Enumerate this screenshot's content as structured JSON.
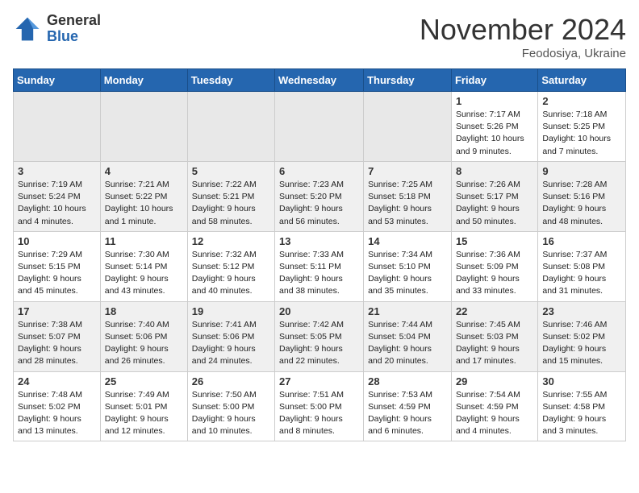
{
  "header": {
    "logo_general": "General",
    "logo_blue": "Blue",
    "month_title": "November 2024",
    "location": "Feodosiya, Ukraine"
  },
  "weekdays": [
    "Sunday",
    "Monday",
    "Tuesday",
    "Wednesday",
    "Thursday",
    "Friday",
    "Saturday"
  ],
  "weeks": [
    [
      {
        "day": "",
        "info": ""
      },
      {
        "day": "",
        "info": ""
      },
      {
        "day": "",
        "info": ""
      },
      {
        "day": "",
        "info": ""
      },
      {
        "day": "",
        "info": ""
      },
      {
        "day": "1",
        "info": "Sunrise: 7:17 AM\nSunset: 5:26 PM\nDaylight: 10 hours and 9 minutes."
      },
      {
        "day": "2",
        "info": "Sunrise: 7:18 AM\nSunset: 5:25 PM\nDaylight: 10 hours and 7 minutes."
      }
    ],
    [
      {
        "day": "3",
        "info": "Sunrise: 7:19 AM\nSunset: 5:24 PM\nDaylight: 10 hours and 4 minutes."
      },
      {
        "day": "4",
        "info": "Sunrise: 7:21 AM\nSunset: 5:22 PM\nDaylight: 10 hours and 1 minute."
      },
      {
        "day": "5",
        "info": "Sunrise: 7:22 AM\nSunset: 5:21 PM\nDaylight: 9 hours and 58 minutes."
      },
      {
        "day": "6",
        "info": "Sunrise: 7:23 AM\nSunset: 5:20 PM\nDaylight: 9 hours and 56 minutes."
      },
      {
        "day": "7",
        "info": "Sunrise: 7:25 AM\nSunset: 5:18 PM\nDaylight: 9 hours and 53 minutes."
      },
      {
        "day": "8",
        "info": "Sunrise: 7:26 AM\nSunset: 5:17 PM\nDaylight: 9 hours and 50 minutes."
      },
      {
        "day": "9",
        "info": "Sunrise: 7:28 AM\nSunset: 5:16 PM\nDaylight: 9 hours and 48 minutes."
      }
    ],
    [
      {
        "day": "10",
        "info": "Sunrise: 7:29 AM\nSunset: 5:15 PM\nDaylight: 9 hours and 45 minutes."
      },
      {
        "day": "11",
        "info": "Sunrise: 7:30 AM\nSunset: 5:14 PM\nDaylight: 9 hours and 43 minutes."
      },
      {
        "day": "12",
        "info": "Sunrise: 7:32 AM\nSunset: 5:12 PM\nDaylight: 9 hours and 40 minutes."
      },
      {
        "day": "13",
        "info": "Sunrise: 7:33 AM\nSunset: 5:11 PM\nDaylight: 9 hours and 38 minutes."
      },
      {
        "day": "14",
        "info": "Sunrise: 7:34 AM\nSunset: 5:10 PM\nDaylight: 9 hours and 35 minutes."
      },
      {
        "day": "15",
        "info": "Sunrise: 7:36 AM\nSunset: 5:09 PM\nDaylight: 9 hours and 33 minutes."
      },
      {
        "day": "16",
        "info": "Sunrise: 7:37 AM\nSunset: 5:08 PM\nDaylight: 9 hours and 31 minutes."
      }
    ],
    [
      {
        "day": "17",
        "info": "Sunrise: 7:38 AM\nSunset: 5:07 PM\nDaylight: 9 hours and 28 minutes."
      },
      {
        "day": "18",
        "info": "Sunrise: 7:40 AM\nSunset: 5:06 PM\nDaylight: 9 hours and 26 minutes."
      },
      {
        "day": "19",
        "info": "Sunrise: 7:41 AM\nSunset: 5:06 PM\nDaylight: 9 hours and 24 minutes."
      },
      {
        "day": "20",
        "info": "Sunrise: 7:42 AM\nSunset: 5:05 PM\nDaylight: 9 hours and 22 minutes."
      },
      {
        "day": "21",
        "info": "Sunrise: 7:44 AM\nSunset: 5:04 PM\nDaylight: 9 hours and 20 minutes."
      },
      {
        "day": "22",
        "info": "Sunrise: 7:45 AM\nSunset: 5:03 PM\nDaylight: 9 hours and 17 minutes."
      },
      {
        "day": "23",
        "info": "Sunrise: 7:46 AM\nSunset: 5:02 PM\nDaylight: 9 hours and 15 minutes."
      }
    ],
    [
      {
        "day": "24",
        "info": "Sunrise: 7:48 AM\nSunset: 5:02 PM\nDaylight: 9 hours and 13 minutes."
      },
      {
        "day": "25",
        "info": "Sunrise: 7:49 AM\nSunset: 5:01 PM\nDaylight: 9 hours and 12 minutes."
      },
      {
        "day": "26",
        "info": "Sunrise: 7:50 AM\nSunset: 5:00 PM\nDaylight: 9 hours and 10 minutes."
      },
      {
        "day": "27",
        "info": "Sunrise: 7:51 AM\nSunset: 5:00 PM\nDaylight: 9 hours and 8 minutes."
      },
      {
        "day": "28",
        "info": "Sunrise: 7:53 AM\nSunset: 4:59 PM\nDaylight: 9 hours and 6 minutes."
      },
      {
        "day": "29",
        "info": "Sunrise: 7:54 AM\nSunset: 4:59 PM\nDaylight: 9 hours and 4 minutes."
      },
      {
        "day": "30",
        "info": "Sunrise: 7:55 AM\nSunset: 4:58 PM\nDaylight: 9 hours and 3 minutes."
      }
    ]
  ]
}
